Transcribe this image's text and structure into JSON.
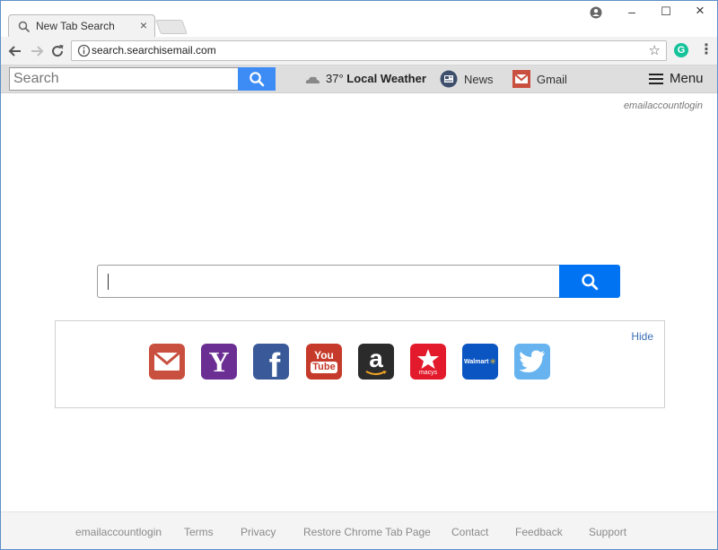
{
  "browser": {
    "tab_title": "New Tab Search",
    "tab_close": "×",
    "url": "search.searchisemail.com",
    "extension_letter": "G",
    "window_controls": [
      "–",
      "☐",
      "×"
    ]
  },
  "header": {
    "search_placeholder": "Search",
    "weather_temp": "37°",
    "weather_label": "Local Weather",
    "news_label": "News",
    "gmail_label": "Gmail",
    "menu_label": "Menu",
    "accent_color": "#3d8bf5"
  },
  "main": {
    "corner_link": "emailaccountlogin",
    "search_value": "",
    "search_button_color": "#0073f3",
    "hide_label": "Hide",
    "shortcuts": [
      {
        "name": "gmail",
        "color": "#c94f3f"
      },
      {
        "name": "yahoo",
        "color": "#6b2f94",
        "text": "Y"
      },
      {
        "name": "facebook",
        "color": "#3a5998",
        "text": "f"
      },
      {
        "name": "youtube",
        "color": "#c53a2b",
        "text_top": "You",
        "text_bottom": "Tube"
      },
      {
        "name": "amazon",
        "color": "#2b2b2b",
        "text": "a"
      },
      {
        "name": "macys",
        "color": "#e21a2c",
        "text": "macys"
      },
      {
        "name": "walmart",
        "color": "#0a55c2",
        "text": "Walmart"
      },
      {
        "name": "twitter",
        "color": "#66b3ef"
      }
    ]
  },
  "footer": {
    "links": [
      "emailaccountlogin",
      "Terms",
      "Privacy",
      "Restore Chrome Tab Page",
      "Contact",
      "Feedback",
      "Support"
    ]
  }
}
